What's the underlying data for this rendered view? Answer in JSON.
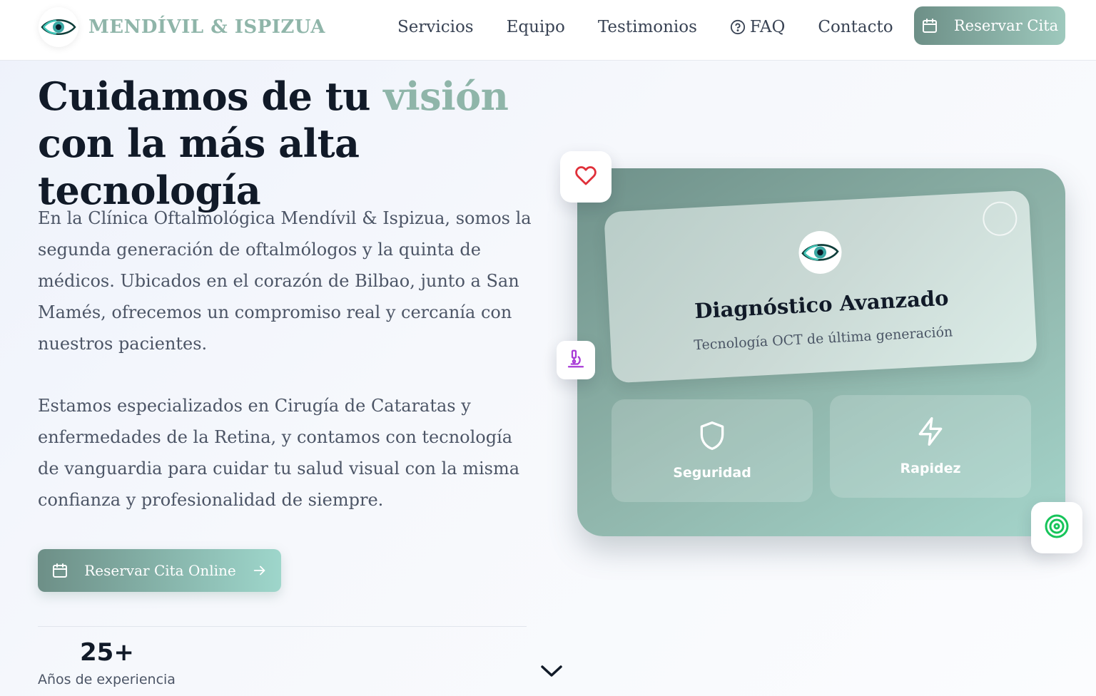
{
  "header": {
    "brand": "MENDÍVIL & ISPIZUA",
    "logo_icon": "eye-icon",
    "nav": [
      {
        "label": "Servicios"
      },
      {
        "label": "Equipo"
      },
      {
        "label": "Testimonios"
      },
      {
        "label": "FAQ",
        "icon": "help-circle-icon"
      },
      {
        "label": "Contacto"
      }
    ],
    "cta_label": "Reservar Cita",
    "cta_icon": "calendar-icon"
  },
  "hero": {
    "title_before": "Cuidamos de tu ",
    "title_accent": "visión",
    "title_after": " con la más alta tecnología",
    "paragraph_1": "En la Clínica Oftalmológica Mendívil & Ispizua, somos la segunda generación de oftalmólogos y la quinta de médicos. Ubicados en el corazón de Bilbao, junto a San Mamés, ofrecemos un compromiso real y cercanía con nuestros pacientes.",
    "paragraph_2": "Estamos especializados en Cirugía de Cataratas y enfermedades de la Retina, y contamos con tecnología de vanguardia para cuidar tu salud visual con la misma confianza y profesionalidad de siempre.",
    "cta_label": "Reservar Cita Online",
    "stat": {
      "value": "25+",
      "label": "Años de experiencia"
    }
  },
  "card": {
    "title": "Diagnóstico Avanzado",
    "subtitle": "Tecnología OCT de última generación",
    "features": [
      {
        "label": "Seguridad",
        "icon": "shield-icon"
      },
      {
        "label": "Rapidez",
        "icon": "zap-icon"
      }
    ],
    "floating_icons": [
      "heart-icon",
      "microscope-icon",
      "target-icon"
    ]
  },
  "colors": {
    "accent": "#8fb5a9",
    "button_start": "#6d8f87",
    "button_end": "#9ec9bd",
    "heart": "#e0303a",
    "microscope": "#a83ad6",
    "target": "#17c45a"
  }
}
